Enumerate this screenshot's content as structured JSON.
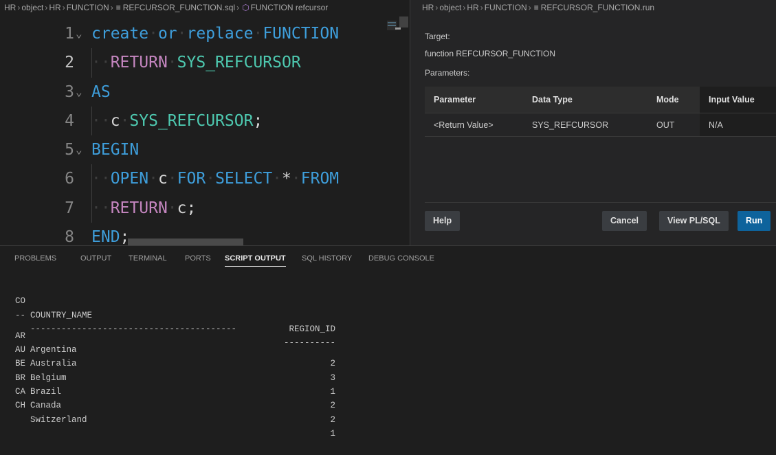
{
  "editor": {
    "breadcrumb": [
      "HR",
      "object",
      "HR",
      "FUNCTION",
      "REFCURSOR_FUNCTION.sql",
      "FUNCTION refcursor"
    ],
    "lines": [
      {
        "n": "1",
        "tokens": [
          [
            "kw",
            "create"
          ],
          [
            "ws",
            "·"
          ],
          [
            "kw",
            "or"
          ],
          [
            "ws",
            "·"
          ],
          [
            "kw",
            "replace"
          ],
          [
            "ws",
            "·"
          ],
          [
            "kw",
            "FUNCTION"
          ]
        ]
      },
      {
        "n": "2",
        "tokens": [
          [
            "ws",
            "··"
          ],
          [
            "kw2",
            "RETURN"
          ],
          [
            "ws",
            "·"
          ],
          [
            "ty",
            "SYS_REFCURSOR"
          ]
        ]
      },
      {
        "n": "3",
        "tokens": [
          [
            "kw",
            "AS"
          ]
        ]
      },
      {
        "n": "4",
        "tokens": [
          [
            "ws",
            "··"
          ],
          [
            "id",
            "c"
          ],
          [
            "ws",
            "·"
          ],
          [
            "ty",
            "SYS_REFCURSOR"
          ],
          [
            "pu",
            ";"
          ]
        ]
      },
      {
        "n": "5",
        "tokens": [
          [
            "kw",
            "BEGIN"
          ]
        ]
      },
      {
        "n": "6",
        "tokens": [
          [
            "ws",
            "··"
          ],
          [
            "kw",
            "OPEN"
          ],
          [
            "ws",
            "·"
          ],
          [
            "id",
            "c"
          ],
          [
            "ws",
            "·"
          ],
          [
            "kw",
            "FOR"
          ],
          [
            "ws",
            "·"
          ],
          [
            "kw",
            "SELECT"
          ],
          [
            "ws",
            "·"
          ],
          [
            "pu",
            "*"
          ],
          [
            "ws",
            "·"
          ],
          [
            "kw",
            "FROM"
          ]
        ]
      },
      {
        "n": "7",
        "tokens": [
          [
            "ws",
            "··"
          ],
          [
            "kw2",
            "RETURN"
          ],
          [
            "ws",
            "·"
          ],
          [
            "id",
            "c"
          ],
          [
            "pu",
            ";"
          ]
        ]
      },
      {
        "n": "8",
        "tokens": [
          [
            "kw",
            "END"
          ],
          [
            "pu",
            ";"
          ]
        ]
      }
    ]
  },
  "run": {
    "breadcrumb": [
      "HR",
      "object",
      "HR",
      "FUNCTION",
      "REFCURSOR_FUNCTION.run"
    ],
    "target_label": "Target:",
    "target_value": "function REFCURSOR_FUNCTION",
    "params_label": "Parameters:",
    "columns": [
      "Parameter",
      "Data Type",
      "Mode",
      "Input Value"
    ],
    "rows": [
      [
        "<Return Value>",
        "SYS_REFCURSOR",
        "OUT",
        "N/A"
      ]
    ],
    "buttons": {
      "help": "Help",
      "cancel": "Cancel",
      "view": "View PL/SQL",
      "run": "Run"
    }
  },
  "panel": {
    "tabs": [
      "PROBLEMS",
      "OUTPUT",
      "TERMINAL",
      "PORTS",
      "SCRIPT OUTPUT",
      "SQL HISTORY",
      "DEBUG CONSOLE"
    ],
    "active_tab": "SCRIPT OUTPUT",
    "output": {
      "header": [
        "CO",
        "COUNTRY_NAME",
        "REGION_ID"
      ],
      "rule": [
        "--",
        "----------------------------------------",
        "----------"
      ],
      "rows": [
        [
          "AR",
          "Argentina",
          "2"
        ],
        [
          "AU",
          "Australia",
          "3"
        ],
        [
          "BE",
          "Belgium",
          "1"
        ],
        [
          "BR",
          "Brazil",
          "2"
        ],
        [
          "CA",
          "Canada",
          "2"
        ],
        [
          "CH",
          "Switzerland",
          "1"
        ]
      ]
    }
  }
}
